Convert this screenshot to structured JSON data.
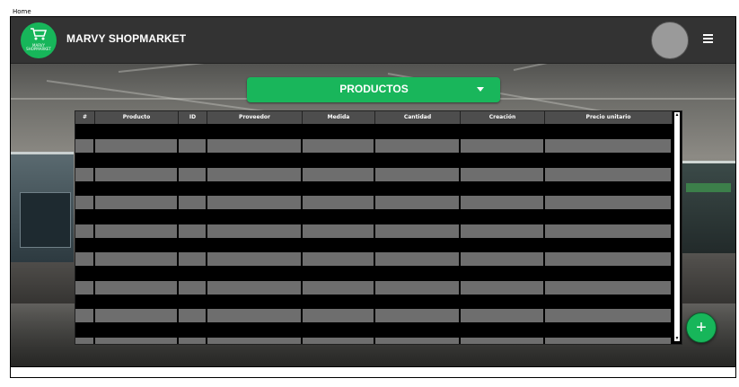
{
  "window": {
    "title": "Home"
  },
  "header": {
    "brand": "MARVY SHOPMARKET",
    "logo_text": "MARVY SHOPMARKET",
    "logo_icon": "shopping-cart-icon",
    "menu_icon": "hamburger-menu-icon"
  },
  "category_select": {
    "label": "PRODUCTOS",
    "icon": "caret-down-icon"
  },
  "table": {
    "columns": [
      "#",
      "Producto",
      "ID",
      "Proveedor",
      "Medida",
      "Cantidad",
      "Creación",
      "Precio unitario"
    ],
    "rows": [
      [
        "",
        "",
        "",
        "",
        "",
        "",
        "",
        ""
      ],
      [
        "",
        "",
        "",
        "",
        "",
        "",
        "",
        ""
      ],
      [
        "",
        "",
        "",
        "",
        "",
        "",
        "",
        ""
      ],
      [
        "",
        "",
        "",
        "",
        "",
        "",
        "",
        ""
      ],
      [
        "",
        "",
        "",
        "",
        "",
        "",
        "",
        ""
      ],
      [
        "",
        "",
        "",
        "",
        "",
        "",
        "",
        ""
      ],
      [
        "",
        "",
        "",
        "",
        "",
        "",
        "",
        ""
      ],
      [
        "",
        "",
        "",
        "",
        "",
        "",
        "",
        ""
      ]
    ]
  },
  "fab": {
    "label": "+",
    "icon": "plus-icon"
  },
  "colors": {
    "accent": "#17b65a",
    "topbar": "#333333",
    "cell": "#6e6e6e"
  }
}
